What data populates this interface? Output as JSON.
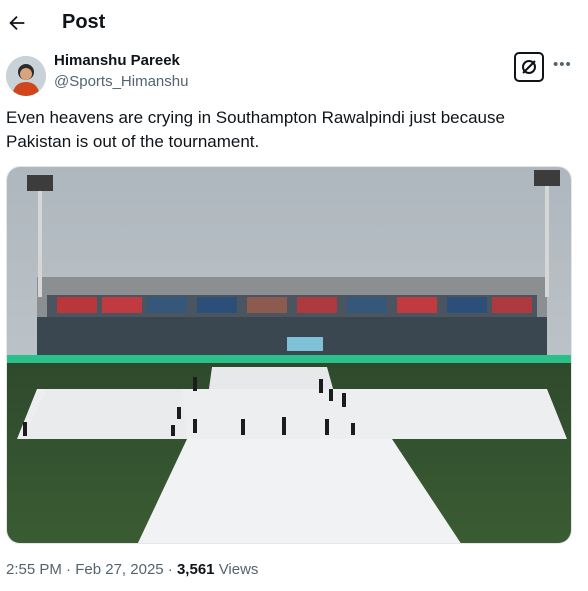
{
  "header": {
    "title": "Post"
  },
  "post": {
    "author_name": "Himanshu Pareek",
    "author_handle": "@Sports_Himanshu",
    "text": "Even heavens are crying in Southampton Rawalpindi just because Pakistan is out of the tournament.",
    "time": "2:55 PM",
    "date": "Feb 27, 2025",
    "views_count": "3,561",
    "views_label": "Views"
  },
  "icons": {
    "back": "arrow-left-icon",
    "grok": "grok-icon",
    "more": "more-icon"
  },
  "colors": {
    "text": "#0f1419",
    "secondary_text": "#536471"
  }
}
